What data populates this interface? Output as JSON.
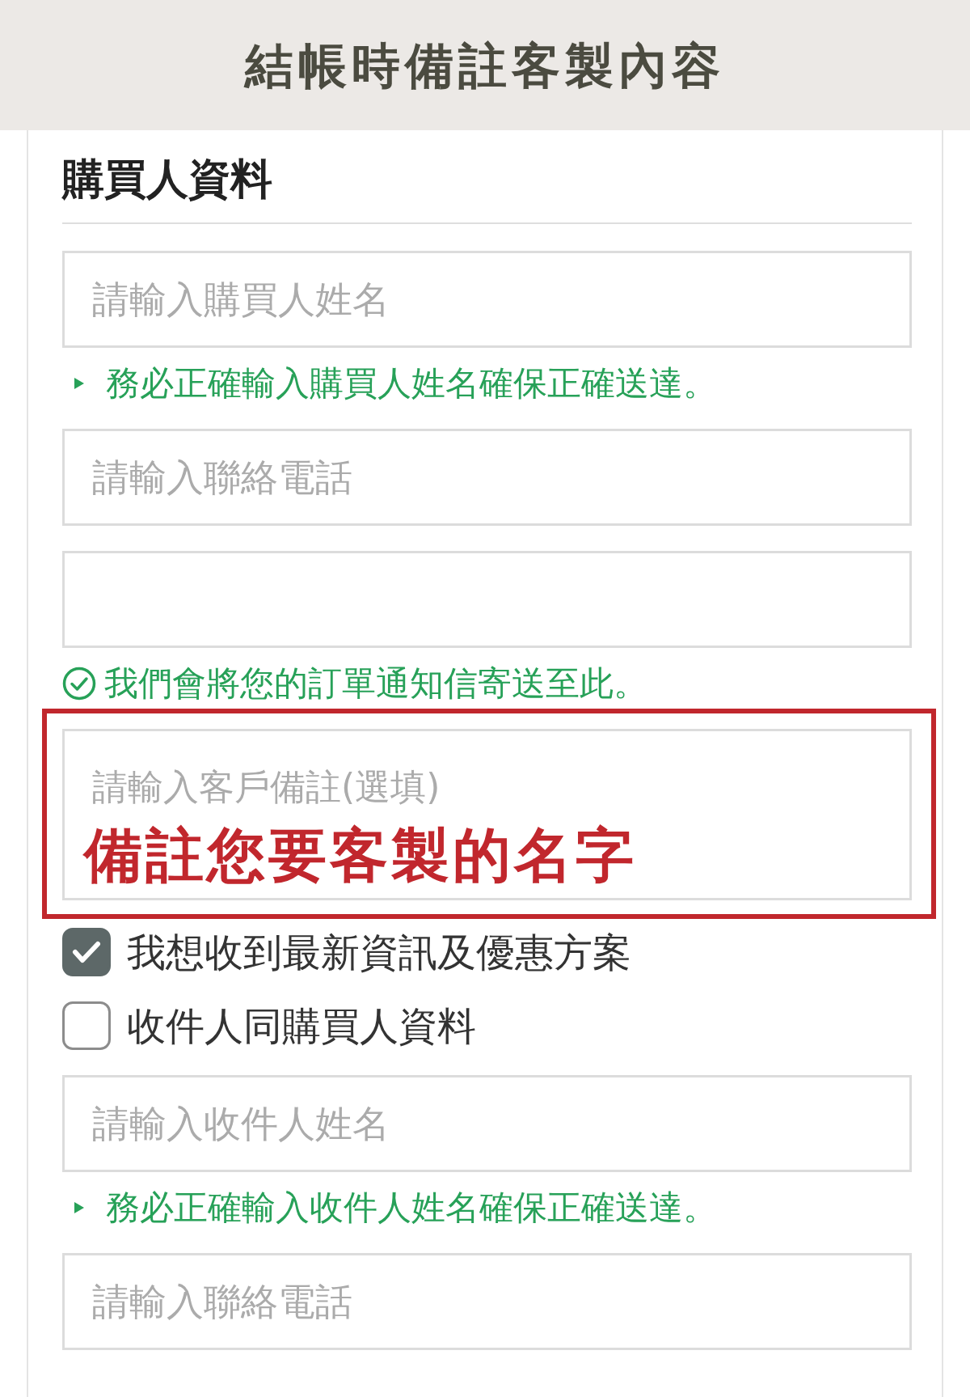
{
  "header": {
    "title": "結帳時備註客製內容"
  },
  "section": {
    "title": "購買人資料"
  },
  "form": [
    {
      "kind": "input",
      "placeholder": "請輸入購買人姓名"
    },
    {
      "kind": "hint",
      "text": "務必正確輸入購買人姓名確保正確送達。"
    },
    {
      "kind": "input",
      "placeholder": "請輸入聯絡電話"
    },
    {
      "kind": "input"
    },
    {
      "kind": "notice",
      "text": "我們會將您的訂單通知信寄送至此。"
    },
    {
      "kind": "note",
      "placeholder": "請輸入客戶備註(選填)",
      "annotation": "備註您要客製的名字",
      "highlighted": true
    },
    {
      "kind": "checkbox",
      "label": "我想收到最新資訊及優惠方案",
      "checked": true
    },
    {
      "kind": "checkbox",
      "label": "收件人同購買人資料",
      "checked": false
    },
    {
      "kind": "input",
      "placeholder": "請輸入收件人姓名"
    },
    {
      "kind": "hint",
      "text": "務必正確輸入收件人姓名確保正確送達。"
    },
    {
      "kind": "input",
      "placeholder": "請輸入聯絡電話"
    }
  ]
}
